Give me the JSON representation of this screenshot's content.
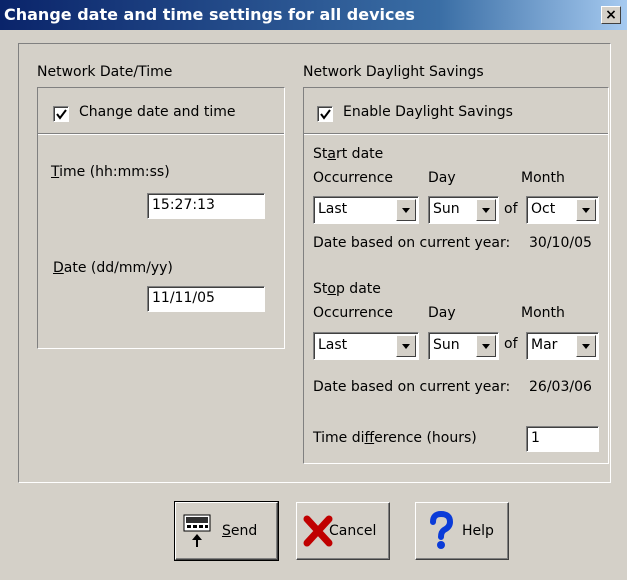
{
  "window": {
    "title": "Change date and time settings for all devices",
    "close_label": "×"
  },
  "network_time": {
    "group_label": "Network Date/Time",
    "change_checkbox_label": "Change date and time",
    "change_checked": true,
    "time_label": "Time (hh:mm:ss)",
    "time_access_key": "T",
    "time_rest": "ime (hh:mm:ss)",
    "time_value": "15:27:13",
    "date_access_key": "D",
    "date_rest": "ate (dd/mm/yy)",
    "date_value": "11/11/05"
  },
  "daylight": {
    "group_label": "Network Daylight Savings",
    "enable_checkbox_label": "Enable Daylight Savings",
    "enable_checked": true,
    "start": {
      "label_pre": "St",
      "label_key": "a",
      "label_post": "rt date",
      "occurrence_header": "Occurrence",
      "day_header": "Day",
      "month_header": "Month",
      "occurrence": "Last",
      "day": "Sun",
      "of_label": "of",
      "month": "Oct",
      "based_text": "Date based on current year:",
      "based_date": "30/10/05"
    },
    "stop": {
      "label_pre": "St",
      "label_key": "o",
      "label_post": "p date",
      "occurrence_header": "Occurrence",
      "day_header": "Day",
      "month_header": "Month",
      "occurrence": "Last",
      "day": "Sun",
      "of_label": "of",
      "month": "Mar",
      "based_text": "Date based on current year:",
      "based_date": "26/03/06"
    },
    "time_diff_pre": "Time di",
    "time_diff_key": "f",
    "time_diff_post": "ference (hours)",
    "time_diff_value": "1"
  },
  "buttons": {
    "send_key": "S",
    "send_rest": "end",
    "cancel": "Cancel",
    "help": "Help"
  }
}
